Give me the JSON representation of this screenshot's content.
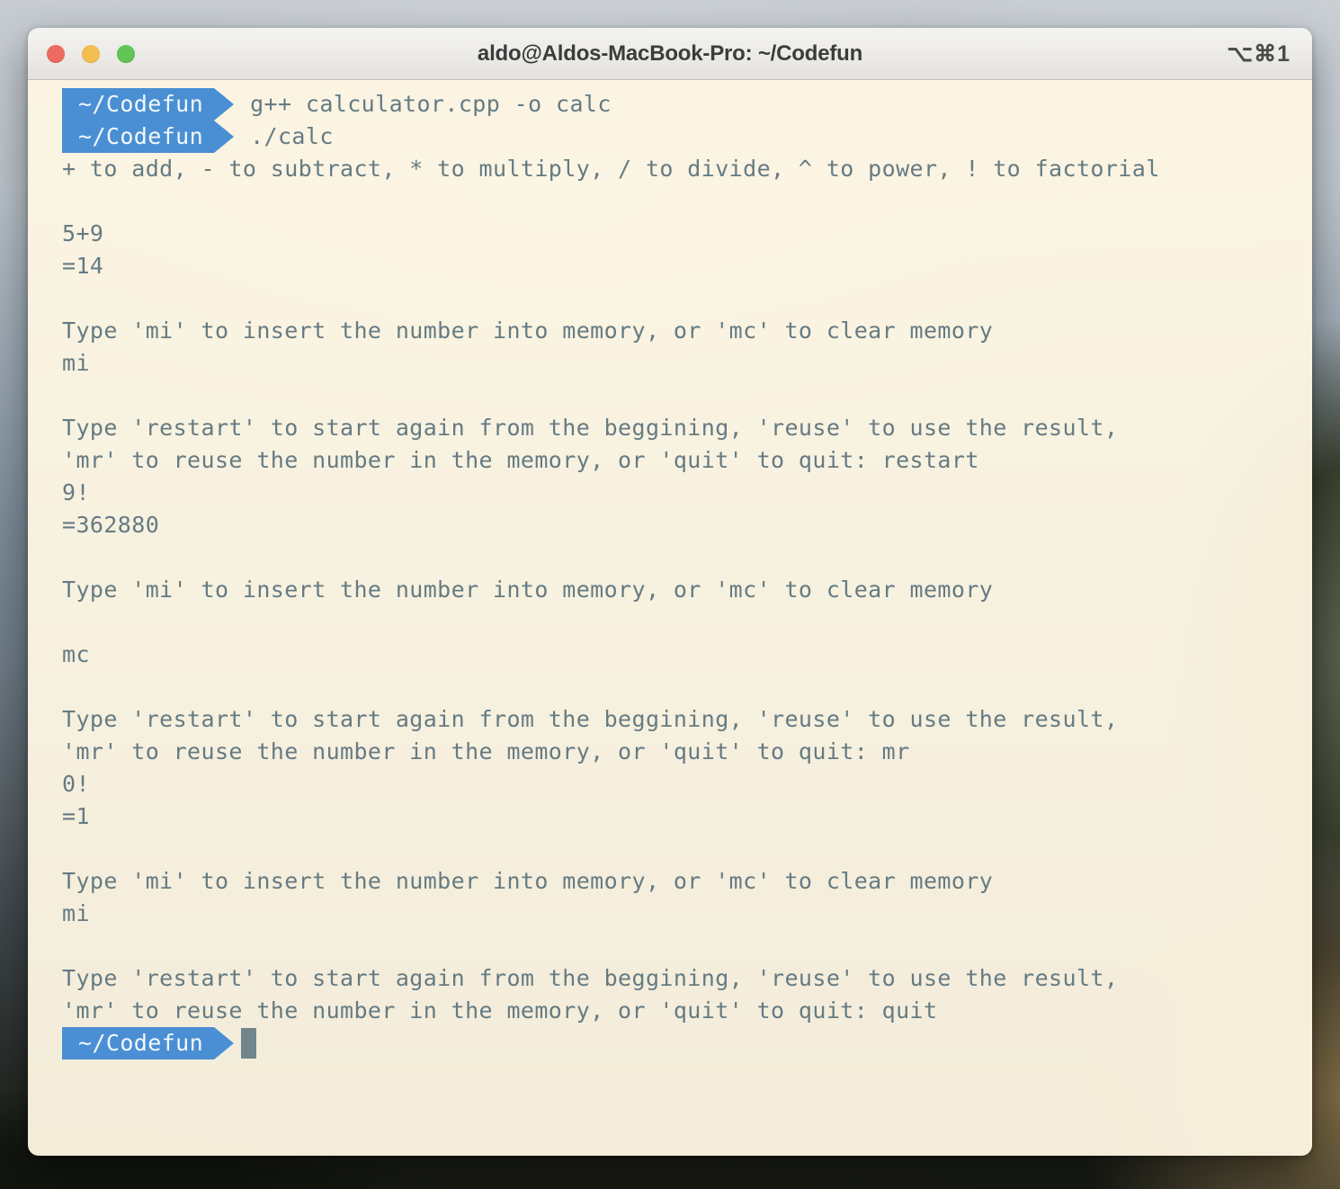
{
  "window": {
    "title": "aldo@Aldos-MacBook-Pro: ~/Codefun",
    "shortcut": "⌥⌘1",
    "traffic_lights": {
      "close_label": "close-window",
      "minimize_label": "minimize-window",
      "zoom_label": "zoom-window"
    },
    "colors": {
      "titlebar_bg": "#ECEAE6",
      "terminal_bg": "#FDF6E3",
      "terminal_text": "#657B83",
      "prompt_badge_bg": "#4A8FD4",
      "prompt_badge_text": "#F4F8FB",
      "cursor": "#73858C",
      "close": "#EC6A5F",
      "minimize": "#F4BD4F",
      "zoom": "#61C454"
    }
  },
  "terminal": {
    "prompt_label": "~/Codefun",
    "lines": [
      {
        "type": "prompt",
        "prompt": "~/Codefun",
        "command": "g++ calculator.cpp -o calc"
      },
      {
        "type": "prompt",
        "prompt": "~/Codefun",
        "command": "./calc"
      },
      {
        "type": "output",
        "text": "+ to add, - to subtract, * to multiply, / to divide, ^ to power, ! to factorial"
      },
      {
        "type": "output",
        "text": ""
      },
      {
        "type": "output",
        "text": "5+9"
      },
      {
        "type": "output",
        "text": "=14"
      },
      {
        "type": "output",
        "text": ""
      },
      {
        "type": "output",
        "text": "Type 'mi' to insert the number into memory, or 'mc' to clear memory"
      },
      {
        "type": "output",
        "text": "mi"
      },
      {
        "type": "output",
        "text": ""
      },
      {
        "type": "output",
        "text": "Type 'restart' to start again from the beggining, 'reuse' to use the result,"
      },
      {
        "type": "output",
        "text": "'mr' to reuse the number in the memory, or 'quit' to quit: restart"
      },
      {
        "type": "output",
        "text": "9!"
      },
      {
        "type": "output",
        "text": "=362880"
      },
      {
        "type": "output",
        "text": ""
      },
      {
        "type": "output",
        "text": "Type 'mi' to insert the number into memory, or 'mc' to clear memory"
      },
      {
        "type": "output",
        "text": ""
      },
      {
        "type": "output",
        "text": "mc"
      },
      {
        "type": "output",
        "text": ""
      },
      {
        "type": "output",
        "text": "Type 'restart' to start again from the beggining, 'reuse' to use the result,"
      },
      {
        "type": "output",
        "text": "'mr' to reuse the number in the memory, or 'quit' to quit: mr"
      },
      {
        "type": "output",
        "text": "0!"
      },
      {
        "type": "output",
        "text": "=1"
      },
      {
        "type": "output",
        "text": ""
      },
      {
        "type": "output",
        "text": "Type 'mi' to insert the number into memory, or 'mc' to clear memory"
      },
      {
        "type": "output",
        "text": "mi"
      },
      {
        "type": "output",
        "text": ""
      },
      {
        "type": "output",
        "text": "Type 'restart' to start again from the beggining, 'reuse' to use the result,"
      },
      {
        "type": "output",
        "text": "'mr' to reuse the number in the memory, or 'quit' to quit: quit"
      },
      {
        "type": "prompt",
        "prompt": "~/Codefun",
        "command": "",
        "cursor": true
      }
    ]
  }
}
